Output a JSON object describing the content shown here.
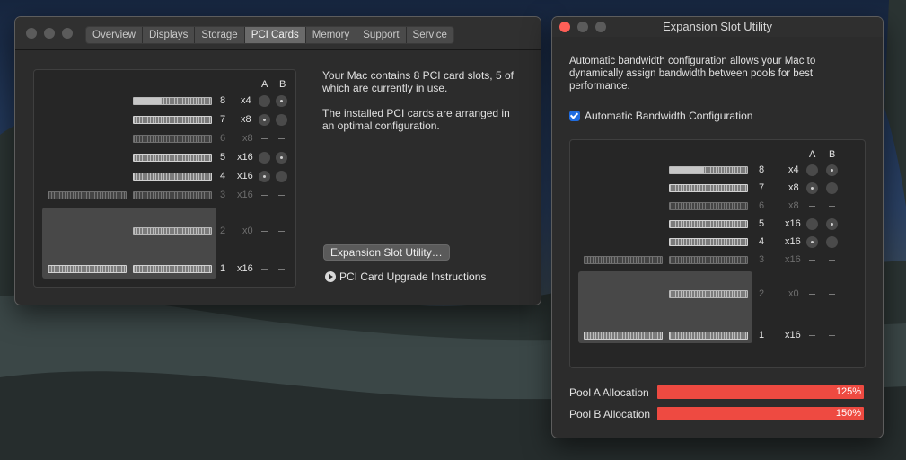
{
  "main_window": {
    "tabs": [
      {
        "label": "Overview",
        "active": false
      },
      {
        "label": "Displays",
        "active": false
      },
      {
        "label": "Storage",
        "active": false
      },
      {
        "label": "PCI Cards",
        "active": true
      },
      {
        "label": "Memory",
        "active": false
      },
      {
        "label": "Support",
        "active": false
      },
      {
        "label": "Service",
        "active": false
      }
    ],
    "description_1": "Your Mac contains 8 PCI card slots, 5 of which are currently in use.",
    "description_2": "The installed PCI cards are arranged in an optimal configuration.",
    "esu_button": "Expansion Slot Utility…",
    "upgrade_link": "PCI Card Upgrade Instructions"
  },
  "esu_window": {
    "title": "Expansion Slot Utility",
    "description": "Automatic bandwidth configuration allows your Mac to dynamically assign bandwidth between pools for best performance.",
    "auto_checkbox_label": "Automatic Bandwidth Configuration",
    "auto_checked": true,
    "pools": [
      {
        "label": "Pool A Allocation",
        "value": "125%"
      },
      {
        "label": "Pool B Allocation",
        "value": "150%"
      }
    ],
    "accent_color": "#ee4a41"
  },
  "pool_headers": {
    "a": "A",
    "b": "B"
  },
  "slots": [
    {
      "num": "8",
      "lanes": "x4",
      "pool": "B",
      "in_use": true
    },
    {
      "num": "7",
      "lanes": "x8",
      "pool": "A",
      "in_use": true
    },
    {
      "num": "6",
      "lanes": "x8",
      "pool": "",
      "in_use": false
    },
    {
      "num": "5",
      "lanes": "x16",
      "pool": "B",
      "in_use": true
    },
    {
      "num": "4",
      "lanes": "x16",
      "pool": "A",
      "in_use": true
    },
    {
      "num": "3",
      "lanes": "x16",
      "pool": "",
      "in_use": false
    },
    {
      "num": "2",
      "lanes": "x0",
      "pool": "",
      "in_use": false
    },
    {
      "num": "1",
      "lanes": "x16",
      "pool": "",
      "in_use": true
    }
  ]
}
